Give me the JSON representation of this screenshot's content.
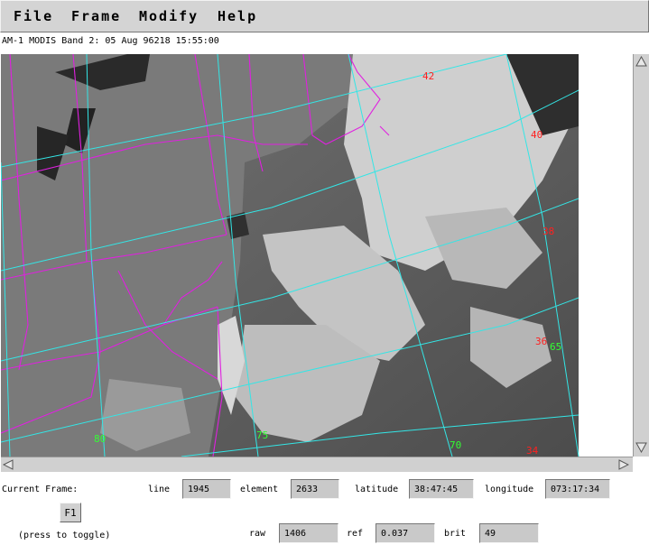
{
  "menu": {
    "items": [
      "File",
      "Frame",
      "Modify",
      "Help"
    ]
  },
  "image_title": "AM-1 MODIS Band 2: 05 Aug 96218 15:55:00",
  "map": {
    "lat_labels": [
      "42",
      "40",
      "38",
      "36",
      "34"
    ],
    "lon_labels": [
      "80",
      "75",
      "70",
      "65"
    ],
    "lat_label_color": "#ff2020",
    "lon_label_color": "#33ff33",
    "grid_color": "#33e6e6",
    "border_color": "#e020e0"
  },
  "readout": {
    "current_frame_label": "Current Frame:",
    "frame_button": "F1",
    "toggle_hint": "(press to toggle)",
    "line_label": "line",
    "line_value": "1945",
    "element_label": "element",
    "element_value": "2633",
    "latitude_label": "latitude",
    "latitude_value": "38:47:45",
    "longitude_label": "longitude",
    "longitude_value": "073:17:34",
    "raw_label": "raw",
    "raw_value": "1406",
    "ref_label": "ref",
    "ref_value": "0.037",
    "brit_label": "brit",
    "brit_value": "49"
  }
}
